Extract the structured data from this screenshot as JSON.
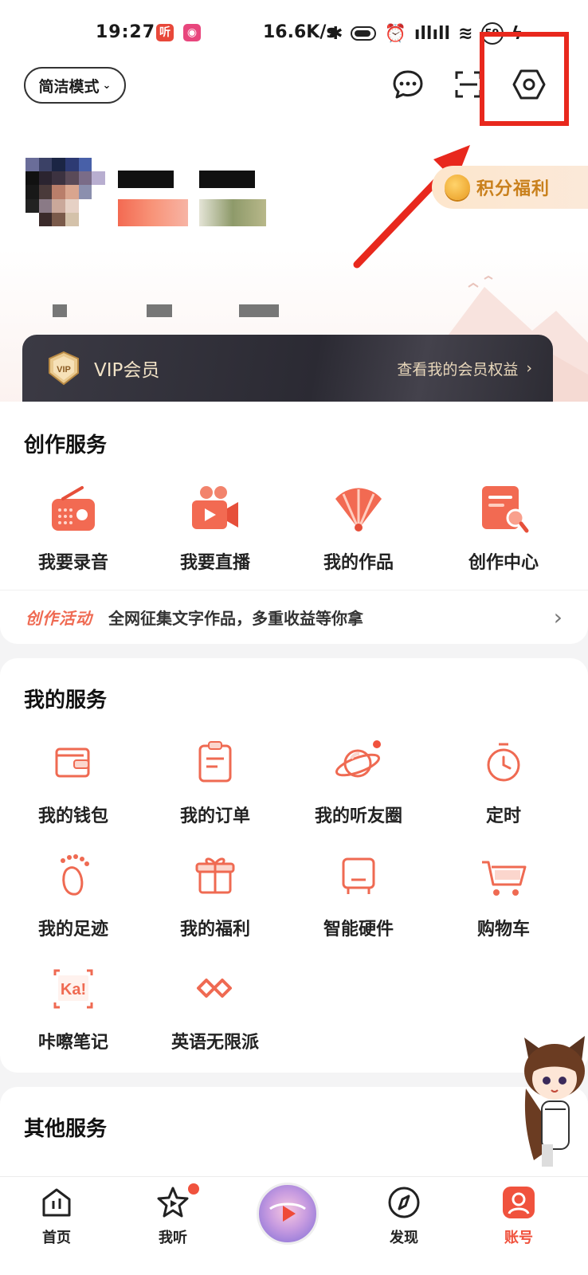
{
  "status_bar": {
    "time": "19:27",
    "net_speed": "16.6K/s",
    "app_icon_1": "听",
    "battery_level": "59"
  },
  "top_bar": {
    "mode_label": "简洁模式",
    "icons": [
      "chat-bubble-icon",
      "scan-icon",
      "settings-icon"
    ]
  },
  "profile": {
    "points_label": "积分福利"
  },
  "vip": {
    "badge_text": "VIP",
    "label": "VIP会员",
    "link": "查看我的会员权益"
  },
  "creation": {
    "title": "创作服务",
    "items": [
      {
        "label": "我要录音",
        "icon": "radio-icon"
      },
      {
        "label": "我要直播",
        "icon": "video-camera-icon"
      },
      {
        "label": "我的作品",
        "icon": "fan-icon"
      },
      {
        "label": "创作中心",
        "icon": "document-search-icon"
      }
    ],
    "activity_tag": "创作活动",
    "activity_text": "全网征集文字作品，多重收益等你拿"
  },
  "my_services": {
    "title": "我的服务",
    "items": [
      {
        "label": "我的钱包",
        "icon": "wallet-icon"
      },
      {
        "label": "我的订单",
        "icon": "order-clipboard-icon"
      },
      {
        "label": "我的听友圈",
        "icon": "planet-icon"
      },
      {
        "label": "定时",
        "icon": "timer-icon"
      },
      {
        "label": "我的足迹",
        "icon": "footprint-icon"
      },
      {
        "label": "我的福利",
        "icon": "gift-icon"
      },
      {
        "label": "智能硬件",
        "icon": "smart-device-icon"
      },
      {
        "label": "购物车",
        "icon": "shopping-cart-icon"
      },
      {
        "label": "咔嚓笔记",
        "icon": "ka-note-icon"
      },
      {
        "label": "英语无限派",
        "icon": "infinity-icon"
      }
    ]
  },
  "other_services": {
    "title": "其他服务"
  },
  "bottom_nav": {
    "items": [
      {
        "label": "首页",
        "icon": "home-icon"
      },
      {
        "label": "我听",
        "icon": "star-icon"
      },
      {
        "label": "发现",
        "icon": "compass-icon"
      },
      {
        "label": "账号",
        "icon": "account-icon"
      }
    ]
  },
  "colors": {
    "accent": "#ef5a41",
    "vip_gold": "#f1e2c6",
    "highlight": "#e8281d"
  }
}
